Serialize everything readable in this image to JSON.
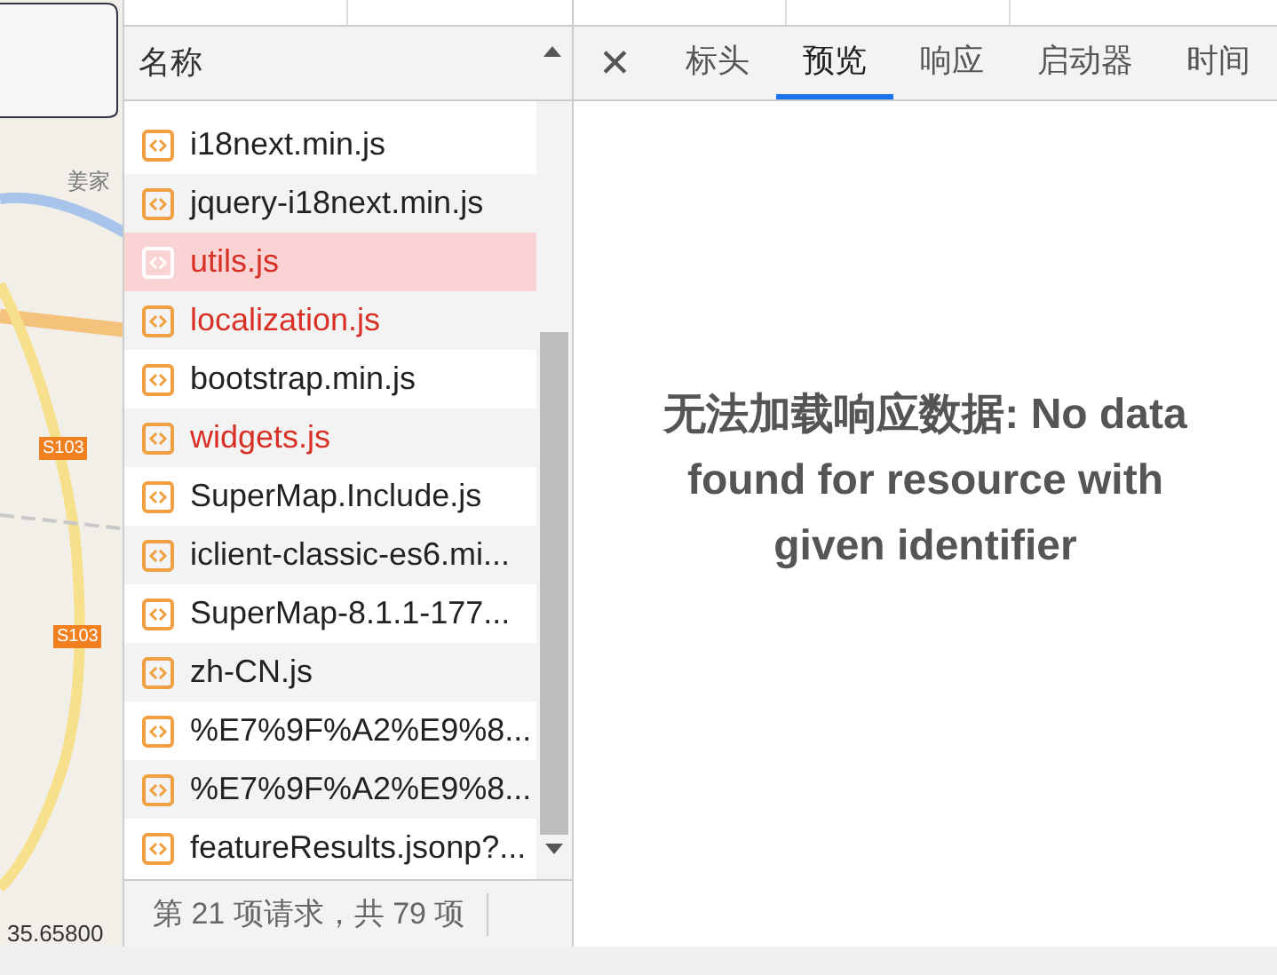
{
  "map": {
    "place_label": "姜家",
    "road_badges": [
      "S103",
      "S103"
    ],
    "coordinate": "35.65800"
  },
  "request_list": {
    "column_header": "名称",
    "rows": [
      {
        "name": "i18next.min.js",
        "failed": false,
        "selected": false
      },
      {
        "name": "jquery-i18next.min.js",
        "failed": false,
        "selected": false
      },
      {
        "name": "utils.js",
        "failed": true,
        "selected": true
      },
      {
        "name": "localization.js",
        "failed": true,
        "selected": false
      },
      {
        "name": "bootstrap.min.js",
        "failed": false,
        "selected": false
      },
      {
        "name": "widgets.js",
        "failed": true,
        "selected": false
      },
      {
        "name": "SuperMap.Include.js",
        "failed": false,
        "selected": false
      },
      {
        "name": "iclient-classic-es6.mi...",
        "failed": false,
        "selected": false
      },
      {
        "name": "SuperMap-8.1.1-177...",
        "failed": false,
        "selected": false
      },
      {
        "name": "zh-CN.js",
        "failed": false,
        "selected": false
      },
      {
        "name": "%E7%9F%A2%E9%8...",
        "failed": false,
        "selected": false
      },
      {
        "name": "%E7%9F%A2%E9%8...",
        "failed": false,
        "selected": false
      },
      {
        "name": "featureResults.jsonp?...",
        "failed": false,
        "selected": false
      }
    ],
    "footer": "第 21 项请求，共 79 项"
  },
  "detail": {
    "close": "✕",
    "tabs": [
      {
        "label": "标头",
        "selected": false
      },
      {
        "label": "预览",
        "selected": true
      },
      {
        "label": "响应",
        "selected": false
      },
      {
        "label": "启动器",
        "selected": false
      },
      {
        "label": "时间",
        "selected": false
      }
    ],
    "message": "无法加载响应数据: No data found for resource with given identifier"
  }
}
